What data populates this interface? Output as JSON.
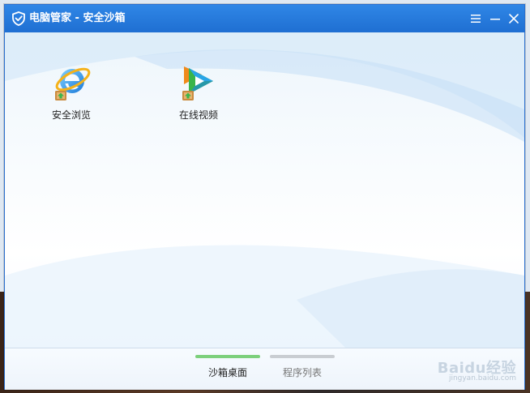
{
  "window": {
    "title": "电脑管家 - 安全沙箱",
    "title_icon": "shield-icon"
  },
  "window_controls": {
    "menu": "menu-icon",
    "minimize": "minimize-icon",
    "close": "close-icon"
  },
  "desktop": {
    "items": [
      {
        "label": "安全浏览",
        "icon": "ie-browser-icon"
      },
      {
        "label": "在线视频",
        "icon": "video-player-icon"
      }
    ]
  },
  "tabs": [
    {
      "label": "沙箱桌面",
      "active": true,
      "indicator_color": "#7dd07c"
    },
    {
      "label": "程序列表",
      "active": false,
      "indicator_color": "#c9cdd2"
    }
  ],
  "watermark": {
    "brand": "Baidu经验",
    "url": "jingyan.baidu.com"
  },
  "colors": {
    "titlebar": "#1f6fd2",
    "active_tab": "#7dd07c",
    "inactive_tab": "#c9cdd2"
  }
}
